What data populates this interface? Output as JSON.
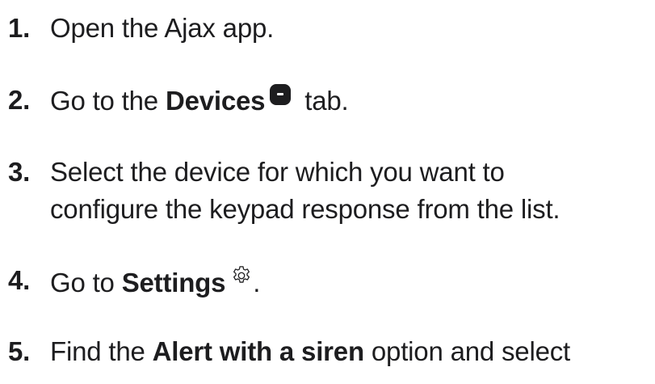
{
  "steps": [
    {
      "num": "1.",
      "text": "Open the Ajax app."
    },
    {
      "num": "2.",
      "pre": "Go to the ",
      "bold": "Devices",
      "post": " tab.",
      "icon": "devices-tab-icon"
    },
    {
      "num": "3.",
      "line1": "Select the device for which you want to",
      "line2": "configure the keypad response from the list."
    },
    {
      "num": "4.",
      "pre": "Go to ",
      "bold": "Settings",
      "post": ".",
      "icon": "gear-icon"
    },
    {
      "num": "5.",
      "pre": "Find the ",
      "bold": "Alert with a siren",
      "post": " option and select"
    }
  ],
  "colors": {
    "text": "#1d1d1f",
    "background": "#ffffff"
  }
}
